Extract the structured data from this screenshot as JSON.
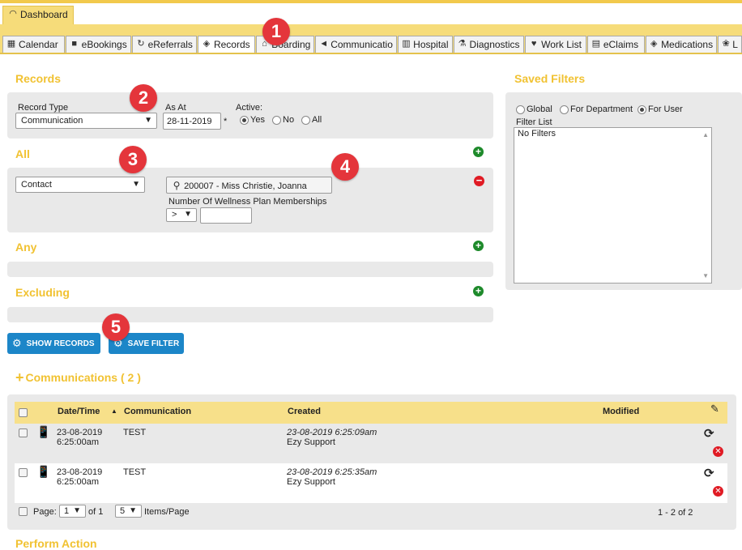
{
  "top": {
    "dashboard_tab": "Dashboard"
  },
  "tabs": [
    {
      "label": "Calendar",
      "icon": "calendar-icon"
    },
    {
      "label": "eBookings",
      "icon": "book-icon"
    },
    {
      "label": "eReferrals",
      "icon": "refresh-icon"
    },
    {
      "label": "Records",
      "icon": "tag-icon",
      "active": true
    },
    {
      "label": "Boarding",
      "icon": "house-icon"
    },
    {
      "label": "Communicatio",
      "icon": "megaphone-icon"
    },
    {
      "label": "Hospital",
      "icon": "building-icon"
    },
    {
      "label": "Diagnostics",
      "icon": "flask-icon"
    },
    {
      "label": "Work List",
      "icon": "heart-icon"
    },
    {
      "label": "eClaims",
      "icon": "claim-icon"
    },
    {
      "label": "Medications",
      "icon": "tag-icon"
    },
    {
      "label": "L",
      "icon": "paw-icon"
    }
  ],
  "badges": [
    "1",
    "2",
    "3",
    "4",
    "5"
  ],
  "records": {
    "title": "Records",
    "record_type_label": "Record Type",
    "record_type_value": "Communication",
    "as_at_label": "As At",
    "as_at_value": "28-11-2019",
    "as_at_required": "*",
    "active_label": "Active:",
    "active_options": [
      "Yes",
      "No",
      "All"
    ],
    "active_selected": "Yes"
  },
  "all": {
    "title": "All",
    "field_select": "Contact",
    "contact_value": "200007 - Miss Christie, Joanna",
    "wellness_label": "Number Of Wellness Plan Memberships",
    "operator_value": ">",
    "number_value": ""
  },
  "any": {
    "title": "Any"
  },
  "excluding": {
    "title": "Excluding"
  },
  "buttons": {
    "show_records": "SHOW RECORDS",
    "save_filter": "SAVE FILTER"
  },
  "saved_filters": {
    "title": "Saved Filters",
    "scope_options": [
      "Global",
      "For Department",
      "For User"
    ],
    "scope_selected": "For User",
    "list_label": "Filter List",
    "list_items": [
      "No Filters"
    ]
  },
  "communications": {
    "title": "Communications ( 2 )",
    "columns": [
      "Date/Time",
      "Communication",
      "Created",
      "Modified"
    ],
    "rows": [
      {
        "date": "23-08-2019",
        "time": "6:25:00am",
        "communication": "TEST",
        "created_at": "23-08-2019 6:25:09am",
        "created_by": "Ezy Support",
        "modified": ""
      },
      {
        "date": "23-08-2019",
        "time": "6:25:00am",
        "communication": "TEST",
        "created_at": "23-08-2019 6:25:35am",
        "created_by": "Ezy Support",
        "modified": ""
      }
    ],
    "pager": {
      "page_label": "Page:",
      "page_value": "1",
      "of_label": "of 1",
      "per_page_value": "5",
      "items_label": "Items/Page",
      "range": "1 - 2 of 2"
    }
  },
  "perform_action": {
    "title": "Perform Action"
  },
  "colors": {
    "accent_yellow": "#f1c232",
    "tab_band": "#f6dc7a",
    "panel_grey": "#e9e9e9",
    "button_blue": "#1c86c8",
    "badge_red": "#e4353b"
  }
}
